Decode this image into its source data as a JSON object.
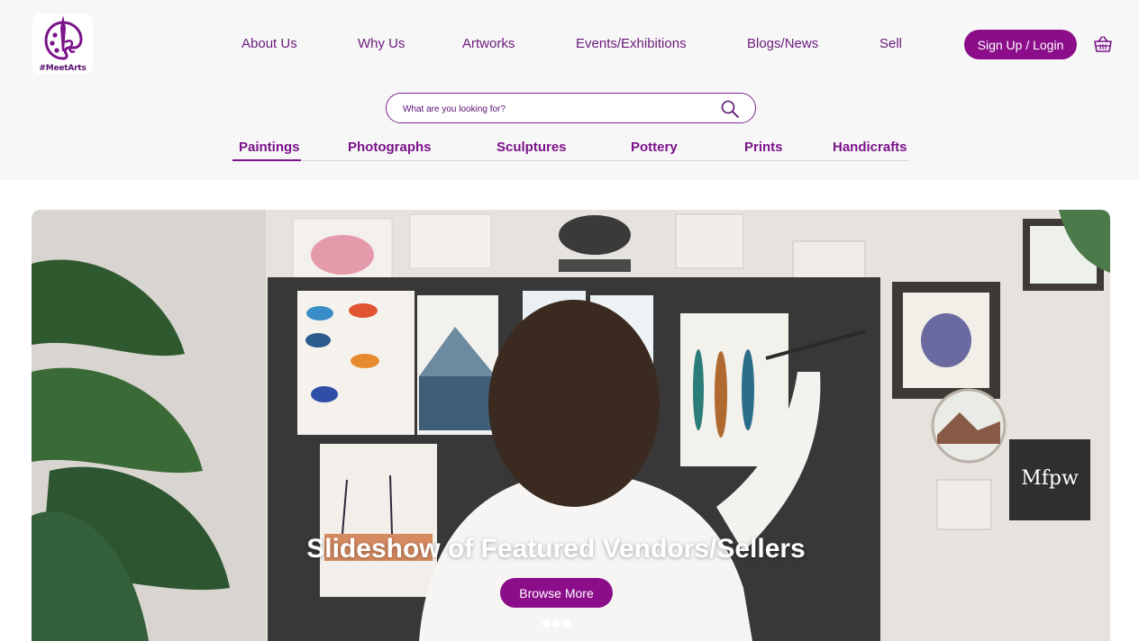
{
  "brand": {
    "name": "#MeetArts"
  },
  "nav": {
    "items": [
      {
        "label": "About Us"
      },
      {
        "label": "Why Us"
      },
      {
        "label": "Artworks"
      },
      {
        "label": "Events/Exhibitions"
      },
      {
        "label": "Blogs/News"
      },
      {
        "label": "Sell"
      }
    ],
    "signup_label": "Sign Up / Login",
    "cart_icon": "basket-icon"
  },
  "search": {
    "placeholder": "What are you looking for?",
    "value": "",
    "icon": "search-icon"
  },
  "categories": {
    "items": [
      {
        "label": "Paintings"
      },
      {
        "label": "Photographs"
      },
      {
        "label": "Sculptures"
      },
      {
        "label": "Pottery"
      },
      {
        "label": "Prints"
      },
      {
        "label": "Handicrafts"
      }
    ],
    "active": "Paintings"
  },
  "hero": {
    "title": "Slideshow of Featured Vendors/Sellers",
    "button_label": "Browse More",
    "slide_count": 3
  },
  "colors": {
    "accent": "#8b0d8a",
    "text": "#6a1b7a",
    "band": "#f8f7f8"
  }
}
